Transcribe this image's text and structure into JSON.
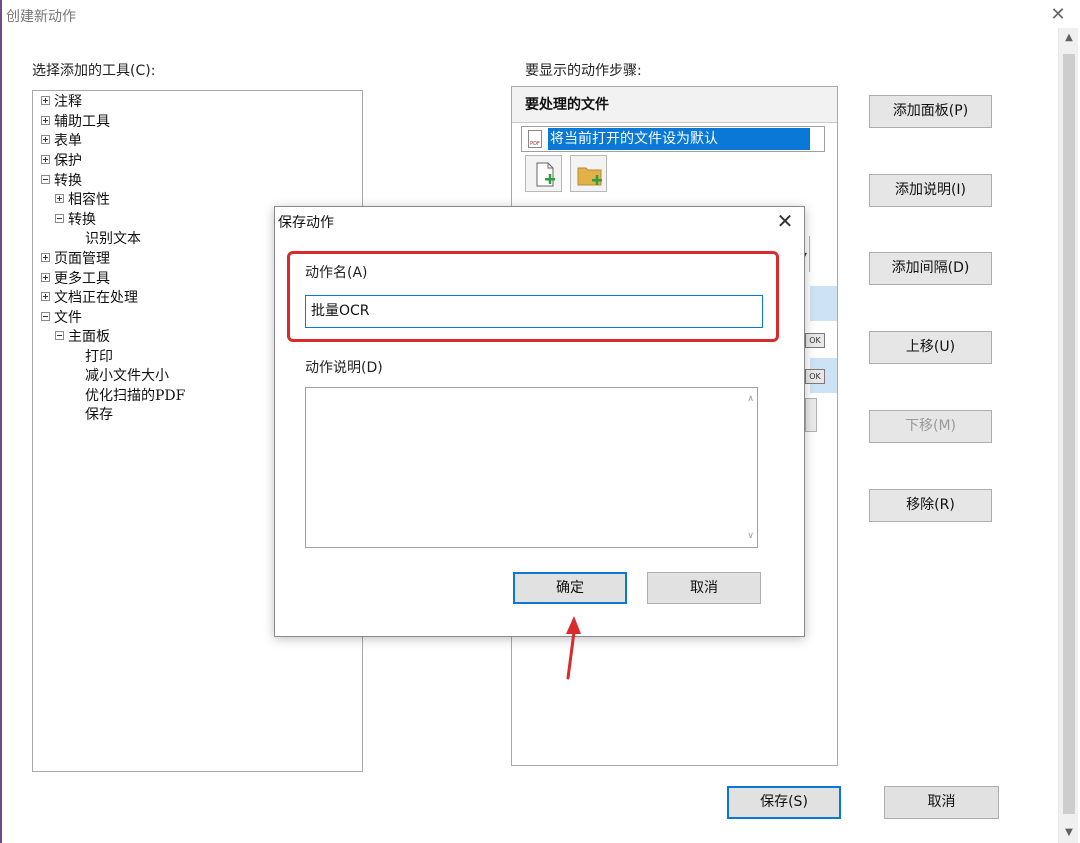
{
  "window": {
    "title": "创建新动作",
    "close_glyph": "✕"
  },
  "left": {
    "label": "选择添加的工具(C):",
    "tree": [
      {
        "label": "注释",
        "expander": "plus"
      },
      {
        "label": "辅助工具",
        "expander": "plus"
      },
      {
        "label": "表单",
        "expander": "plus"
      },
      {
        "label": "保护",
        "expander": "plus"
      },
      {
        "label": "转换",
        "expander": "minus"
      },
      {
        "label": "相容性",
        "expander": "plus"
      },
      {
        "label": "转换",
        "expander": "minus"
      },
      {
        "label": "识别文本",
        "expander": "none"
      },
      {
        "label": "页面管理",
        "expander": "plus"
      },
      {
        "label": "更多工具",
        "expander": "plus"
      },
      {
        "label": "文档正在处理",
        "expander": "plus"
      },
      {
        "label": "文件",
        "expander": "minus"
      },
      {
        "label": "主面板",
        "expander": "minus"
      },
      {
        "label": "打印",
        "expander": "none"
      },
      {
        "label": "减小文件大小",
        "expander": "none"
      },
      {
        "label": "优化扫描的PDF",
        "expander": "none"
      },
      {
        "label": "保存",
        "expander": "none"
      }
    ]
  },
  "right": {
    "label": "要显示的动作步骤:",
    "section_header": "要处理的文件",
    "file_option": "将当前打开的文件设为默认",
    "pdf_icon_text": "PDF",
    "ok_tag": "OK"
  },
  "side_buttons": {
    "add_panel": "添加面板(P)",
    "add_note": "添加说明(I)",
    "add_separator": "添加间隔(D)",
    "move_up": "上移(U)",
    "move_down": "下移(M)",
    "remove": "移除(R)"
  },
  "dialog": {
    "title": "保存动作",
    "close_glyph": "✕",
    "name_label": "动作名(A)",
    "name_value": "批量OCR",
    "desc_label": "动作说明(D)",
    "ok": "确定",
    "cancel": "取消"
  },
  "footer": {
    "save": "保存(S)",
    "cancel": "取消"
  },
  "colors": {
    "accent": "#0a78d7",
    "annotation_red": "#d92b2b",
    "selection": "#0a78d7"
  }
}
